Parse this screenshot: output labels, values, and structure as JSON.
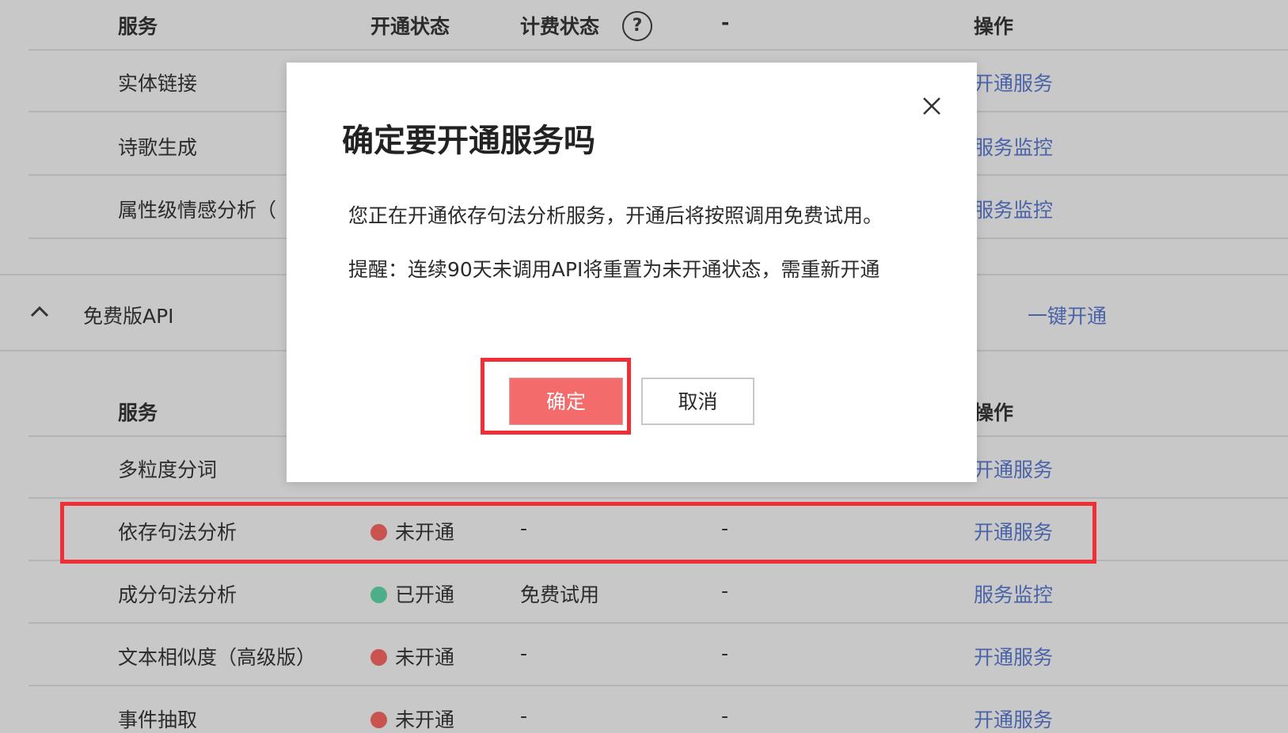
{
  "table1": {
    "headers": {
      "service": "服务",
      "status": "开通状态",
      "billing": "计费状态",
      "col4": "-",
      "action": "操作"
    },
    "rows": [
      {
        "name": "实体链接",
        "action": "开通服务"
      },
      {
        "name": "诗歌生成",
        "action": "服务监控"
      },
      {
        "name": "属性级情感分析（",
        "action": "服务监控"
      }
    ]
  },
  "section": {
    "title": "免费版API",
    "bulk_action": "一键开通"
  },
  "table2": {
    "headers": {
      "service": "服务",
      "action": "操作"
    },
    "rows": [
      {
        "name": "多粒度分词",
        "status": "",
        "billing": "",
        "col4": "",
        "action": "开通服务"
      },
      {
        "name": "依存句法分析",
        "status": "未开通",
        "status_color": "#c9534f",
        "billing": "-",
        "col4": "-",
        "action": "开通服务"
      },
      {
        "name": "成分句法分析",
        "status": "已开通",
        "status_color": "#4fae8a",
        "billing": "免费试用",
        "col4": "-",
        "action": "服务监控"
      },
      {
        "name": "文本相似度（高级版）",
        "status": "未开通",
        "status_color": "#c9534f",
        "billing": "-",
        "col4": "-",
        "action": "开通服务"
      },
      {
        "name": "事件抽取",
        "status": "未开通",
        "status_color": "#c9534f",
        "billing": "-",
        "col4": "-",
        "action": "开通服务"
      }
    ]
  },
  "modal": {
    "title": "确定要开通服务吗",
    "message": "您正在开通依存句法分析服务，开通后将按照调用免费试用。",
    "reminder": "提醒：连续90天未调用API将重置为未开通状态，需重新开通",
    "confirm_label": "确定",
    "cancel_label": "取消"
  },
  "colors": {
    "link": "#4a63a8",
    "highlight": "#ef2f35",
    "confirm_button": "#f36b6b"
  },
  "icons": [
    "help-icon",
    "chevron-up-icon",
    "close-icon"
  ]
}
